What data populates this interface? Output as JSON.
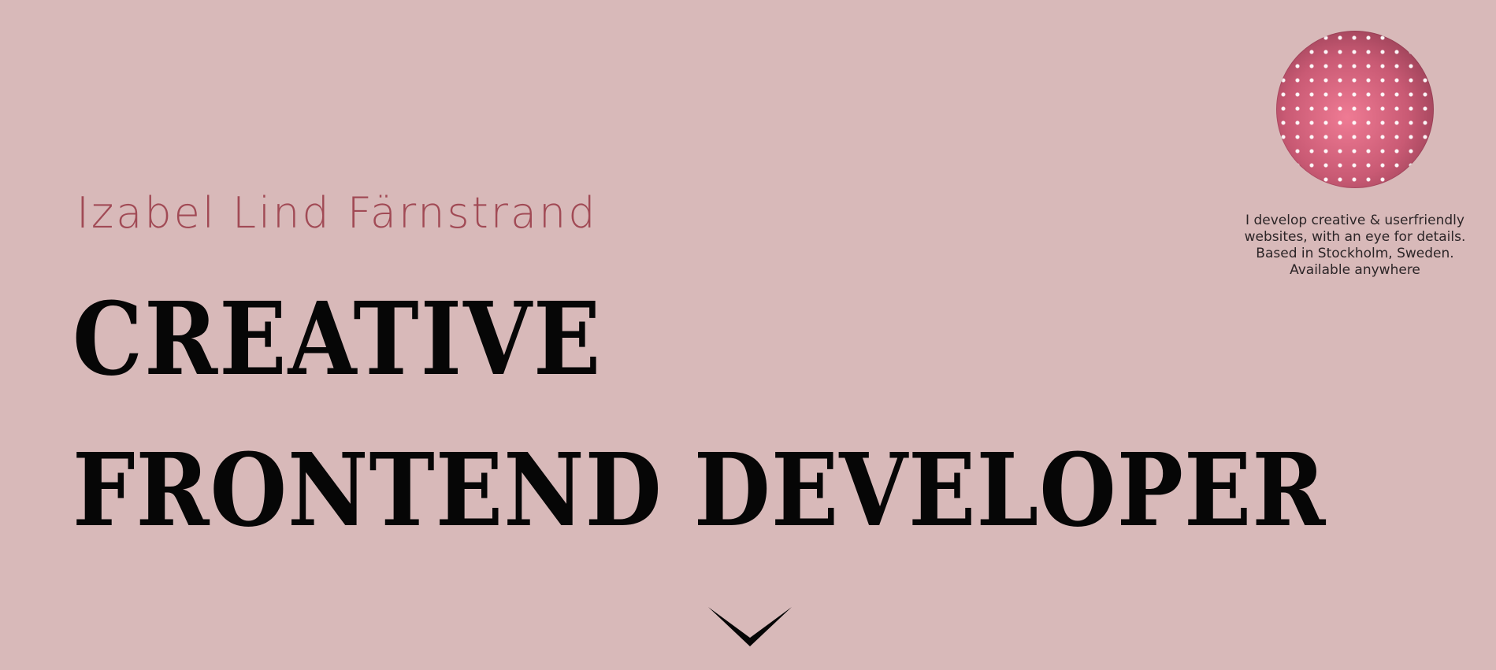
{
  "hero": {
    "name": "Izabel Lind Färnstrand",
    "headline_line_1": "CREATIVE",
    "headline_line_2": "FRONTEND DEVELOPER"
  },
  "profile": {
    "intro_lines": [
      "I develop creative & userfriendly",
      "websites, with an eye for details.",
      "Based in Stockholm, Sweden.",
      "Available anywhere"
    ],
    "icon": "profile-photo"
  },
  "scroll": {
    "icon": "chevron-down-icon"
  },
  "colors": {
    "background": "#d8b9b9",
    "name": "#a14a55",
    "headline": "#060606"
  }
}
